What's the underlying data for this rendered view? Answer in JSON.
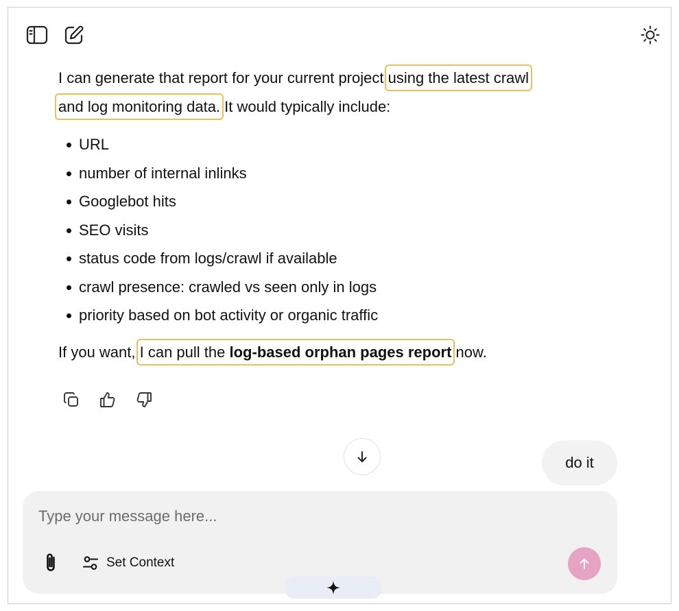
{
  "toolbar": {
    "sidebar_icon": "sidebar-toggle-icon",
    "new_chat_icon": "edit-icon",
    "theme_icon": "sun-icon"
  },
  "message": {
    "p1_a": "I can generate that report for your current project ",
    "p1_hl1": "using the latest crawl",
    "p1_hl2": "and log monitoring data.",
    "p1_b": " It would typically include:",
    "bullets": [
      "URL",
      "number of internal inlinks",
      "Googlebot hits",
      "SEO visits",
      "status code from logs/crawl if available",
      "crawl presence: crawled vs seen only in logs",
      "priority based on bot activity or organic traffic"
    ],
    "p2_a": "If you want, ",
    "p2_hl_a": "I can pull the ",
    "p2_hl_bold": "log-based orphan pages report",
    "p2_b": " now."
  },
  "actions": {
    "copy_icon": "copy-icon",
    "like_icon": "thumbs-up-icon",
    "dislike_icon": "thumbs-down-icon"
  },
  "user_message": "do it",
  "composer": {
    "placeholder": "Type your message here...",
    "value": "",
    "set_context_label": "Set Context"
  },
  "colors": {
    "highlight": "#e6c15c",
    "send_button": "#e7a3c3",
    "composer_bg": "#f1f1f1"
  }
}
